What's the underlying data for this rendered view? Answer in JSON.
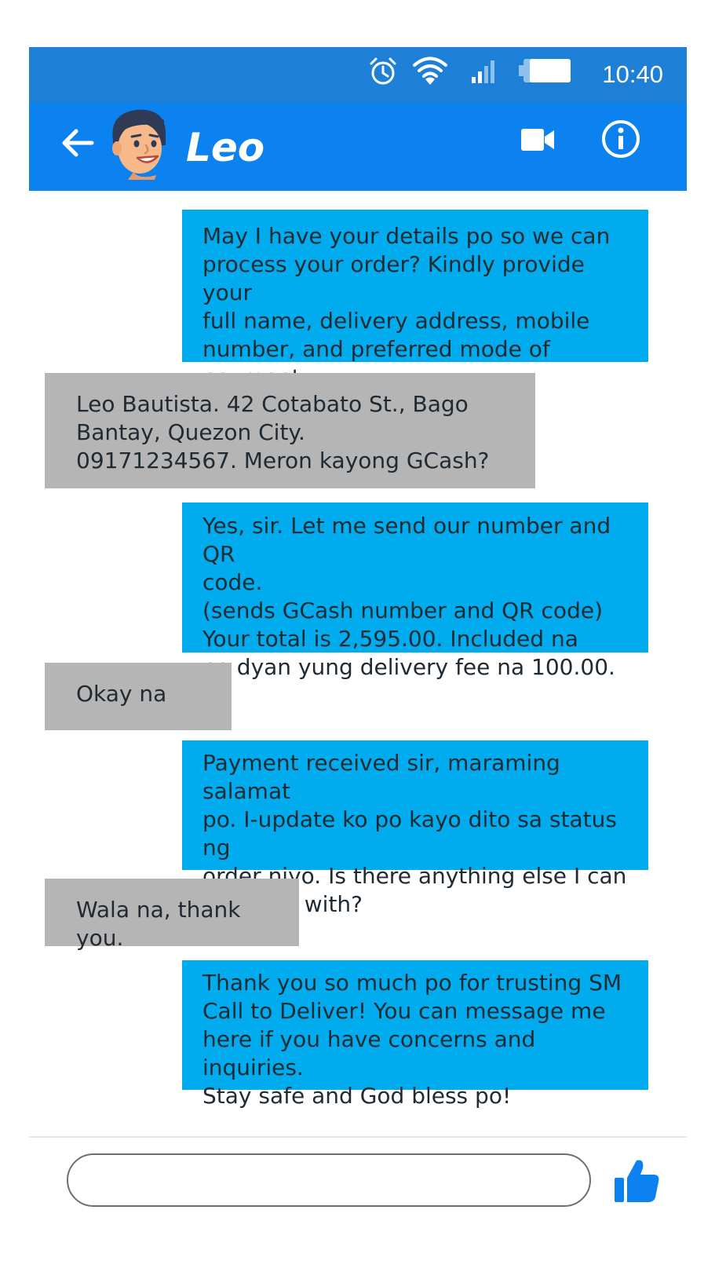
{
  "status_bar": {
    "time": "10:40",
    "icons": [
      "alarm-icon",
      "wifi-icon",
      "signal-icon",
      "battery-icon"
    ]
  },
  "header": {
    "contact_name": "Leo",
    "icons": [
      "back-arrow-icon",
      "avatar",
      "video-call-icon",
      "info-icon"
    ]
  },
  "messages": [
    {
      "sender": "agent",
      "text": "May I have your details po so we can\nprocess your order? Kindly provide your\nfull name, delivery address, mobile\nnumber, and preferred mode of\npayment."
    },
    {
      "sender": "customer",
      "text": "Leo Bautista. 42 Cotabato St., Bago\nBantay, Quezon City.\n09171234567. Meron kayong GCash?"
    },
    {
      "sender": "agent",
      "text": "Yes, sir. Let me send our number and QR\ncode.\n(sends GCash number and QR code)\nYour total is 2,595.00. Included na\npo dyan yung delivery fee na 100.00."
    },
    {
      "sender": "customer",
      "text": "Okay na"
    },
    {
      "sender": "agent",
      "text": "Payment received sir, maraming salamat\npo. I-update ko po kayo dito sa status ng\norder niyo. Is there anything else I can\nhelp you with?"
    },
    {
      "sender": "customer",
      "text": "Wala na, thank you."
    },
    {
      "sender": "agent",
      "text": "Thank you so much po for trusting SM\nCall to Deliver! You can message me\nhere if you have concerns and inquiries.\nStay safe and God bless po!"
    }
  ],
  "composer": {
    "input_value": "",
    "input_placeholder": "",
    "send_icon": "thumbs-up-icon"
  },
  "colors": {
    "status_bar": "#1e7fd6",
    "header": "#0b82f0",
    "outgoing_bubble": "#00aced",
    "incoming_bubble": "#b5b5b5",
    "like_icon": "#0b82f0"
  }
}
